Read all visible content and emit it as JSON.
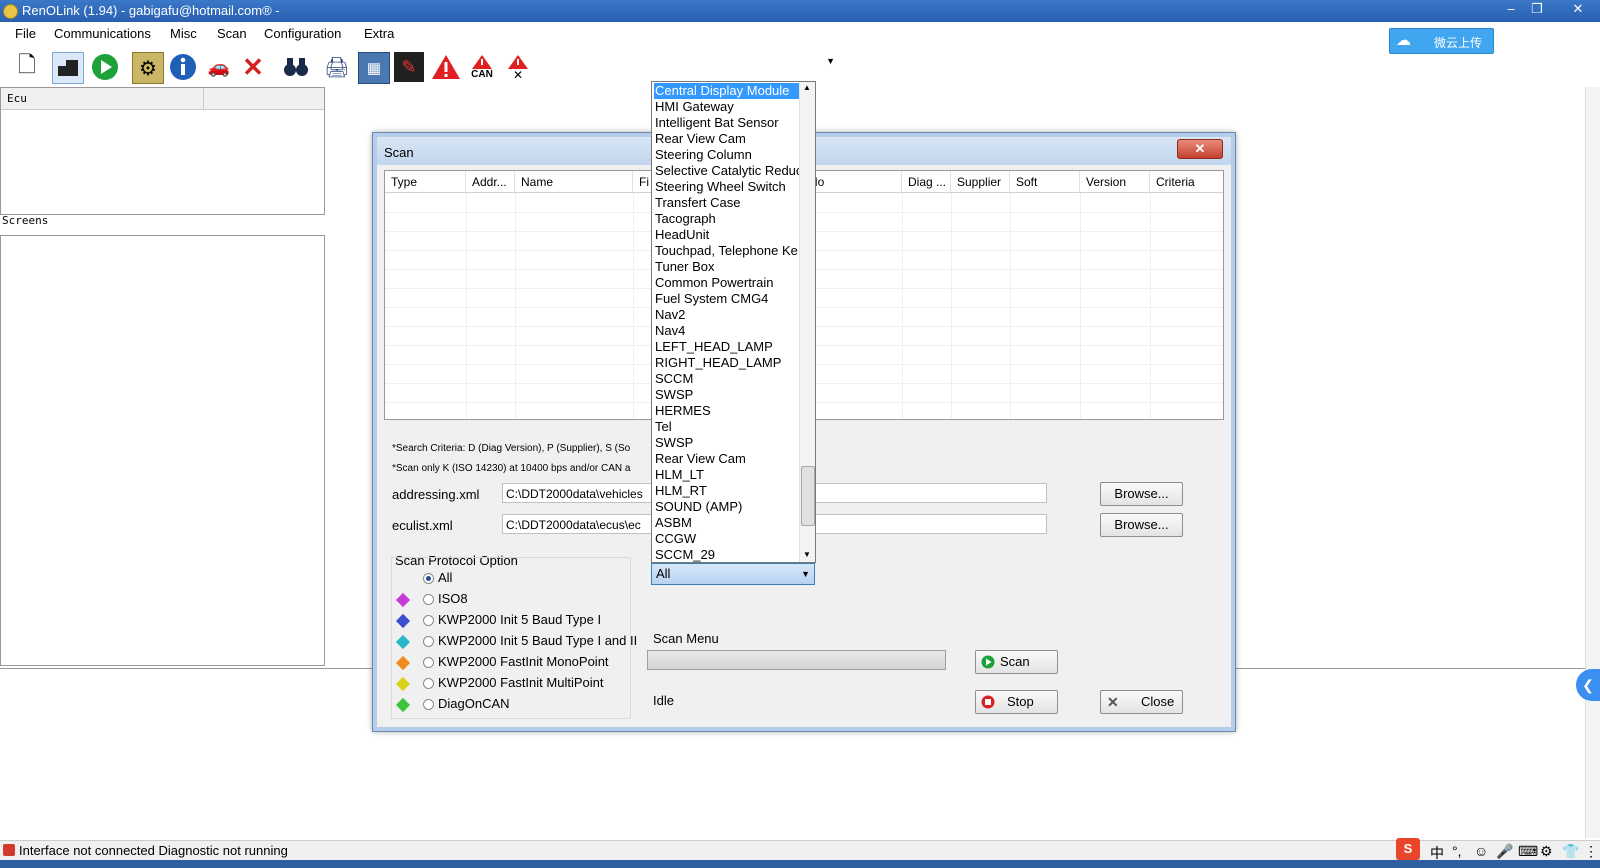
{
  "window": {
    "title": "RenOLink (1.94) - gabigafu@hotmail.com® -",
    "minimize": "–",
    "restore": "❐",
    "close": "✕"
  },
  "menubar": {
    "items": [
      "File",
      "Communications",
      "Misc",
      "Scan",
      "Configuration",
      "Extra"
    ]
  },
  "cloud_button": {
    "label": "微云上传",
    "icon": "cloud-icon"
  },
  "toolbar": {
    "icons": [
      "new-document-icon",
      "connect-icon",
      "play-icon",
      "gear-icon",
      "info-icon",
      "vehicle-icon",
      "cancel-icon",
      "binoculars-icon",
      "printer-icon",
      "calculator-icon",
      "pen-icon",
      "warning-icon",
      "can-warning-icon",
      "clear-warning-icon"
    ],
    "can_label": "CAN",
    "combo_value": ""
  },
  "left_panel": {
    "ecu_header": "Ecu",
    "screens_label": "Screens"
  },
  "status": {
    "text": "Interface not connected Diagnostic not running"
  },
  "ime": {
    "symbols": [
      "中",
      "°,",
      "☺",
      "🎤",
      "⌨",
      "⚙",
      "👕",
      "⋮"
    ]
  },
  "dialog": {
    "title": "Scan",
    "close": "✕",
    "columns": [
      "Type",
      "Addr...",
      "Name",
      "Fi",
      "No",
      "Diag ...",
      "Supplier",
      "Soft",
      "Version",
      "Criteria"
    ],
    "note1": "*Search Criteria: D (Diag Version), P (Supplier), S (So",
    "note2": "*Scan only K (ISO 14230) at 10400 bps and/or CAN a",
    "addressing_label": "addressing.xml",
    "addressing_value": "C:\\DDT2000data\\vehicles",
    "eculist_label": "eculist.xml",
    "eculist_value": "C:\\DDT2000data\\ecus\\ec",
    "browse1": "Browse...",
    "browse2": "Browse...",
    "protocol_group": "Scan Protocol Option",
    "protocols": [
      {
        "label": "All",
        "color": "",
        "selected": true
      },
      {
        "label": "ISO8",
        "color": "#c43bd8",
        "selected": false
      },
      {
        "label": "KWP2000 Init 5 Baud Type I",
        "color": "#3a4fd0",
        "selected": false
      },
      {
        "label": "KWP2000 Init 5 Baud Type I and II",
        "color": "#27b7c7",
        "selected": false
      },
      {
        "label": "KWP2000 FastInit MonoPoint",
        "color": "#f08a1c",
        "selected": false
      },
      {
        "label": "KWP2000 FastInit MultiPoint",
        "color": "#d8d21a",
        "selected": false
      },
      {
        "label": "DiagOnCAN",
        "color": "#3cc43c",
        "selected": false
      }
    ],
    "scan_menu_label": "Scan Menu",
    "progress": 0,
    "status": "Idle",
    "scan_button": "Scan",
    "stop_button": "Stop",
    "close_button": "Close",
    "filter_value": "All",
    "filter_options": [
      "Central Display Module",
      "HMI Gateway",
      "Intelligent Bat Sensor",
      "Rear View Cam",
      "Steering Column",
      "Selective Catalytic Reduc",
      "Steering Wheel Switch",
      "Transfert Case",
      "Tacograph",
      "HeadUnit",
      "Touchpad, Telephone Ke",
      "Tuner Box",
      "Common Powertrain",
      "Fuel System CMG4",
      "Nav2",
      "Nav4",
      "LEFT_HEAD_LAMP",
      "RIGHT_HEAD_LAMP",
      "SCCM",
      "SWSP",
      "HERMES",
      "Tel",
      "SWSP",
      "Rear View Cam",
      "HLM_LT",
      "HLM_RT",
      "SOUND (AMP)",
      "ASBM",
      "CCGW",
      "SCCM_29"
    ]
  }
}
